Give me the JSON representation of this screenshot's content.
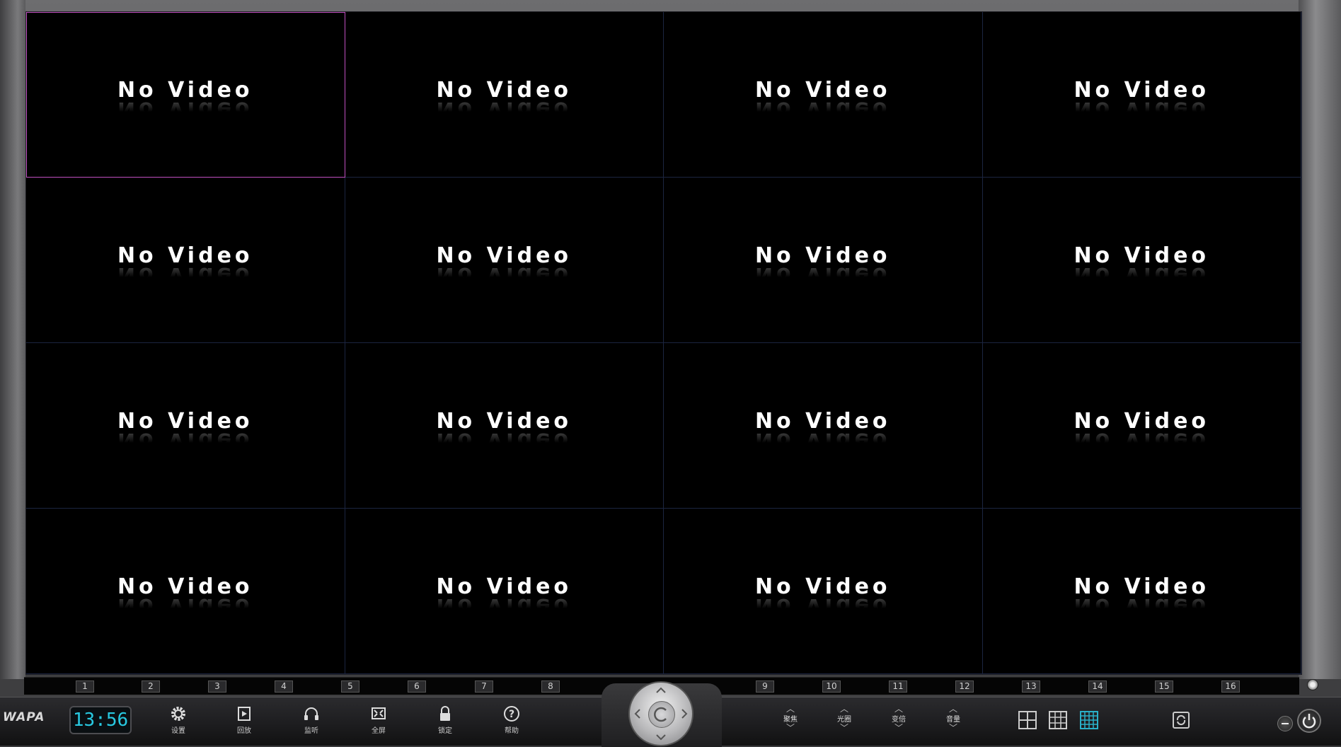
{
  "cells": [
    {
      "label": "No Video"
    },
    {
      "label": "No Video"
    },
    {
      "label": "No Video"
    },
    {
      "label": "No Video"
    },
    {
      "label": "No Video"
    },
    {
      "label": "No Video"
    },
    {
      "label": "No Video"
    },
    {
      "label": "No Video"
    },
    {
      "label": "No Video"
    },
    {
      "label": "No Video"
    },
    {
      "label": "No Video"
    },
    {
      "label": "No Video"
    },
    {
      "label": "No Video"
    },
    {
      "label": "No Video"
    },
    {
      "label": "No Video"
    },
    {
      "label": "No Video"
    }
  ],
  "selected_cell": 1,
  "channels": [
    "1",
    "2",
    "3",
    "4",
    "5",
    "6",
    "7",
    "8",
    "9",
    "10",
    "11",
    "12",
    "13",
    "14",
    "15",
    "16"
  ],
  "brand": "WAPA",
  "clock": "13:56",
  "toolbar": {
    "settings": {
      "label": "设置",
      "icon": "gear-icon"
    },
    "playback": {
      "label": "回放",
      "icon": "playback-icon"
    },
    "listen": {
      "label": "监听",
      "icon": "headphones-icon"
    },
    "fullscreen": {
      "label": "全屏",
      "icon": "fullscreen-icon"
    },
    "lock": {
      "label": "锁定",
      "icon": "lock-icon"
    },
    "help": {
      "label": "帮助",
      "icon": "help-icon"
    }
  },
  "adjust": {
    "focus": {
      "label": "聚焦"
    },
    "iris": {
      "label": "光圈"
    },
    "zoom": {
      "label": "变倍"
    },
    "volume": {
      "label": "音量"
    }
  },
  "layouts": {
    "quad": {
      "icon": "grid-2x2-icon"
    },
    "nine": {
      "icon": "grid-3x3-icon"
    },
    "sixteen": {
      "icon": "grid-4x4-icon",
      "active": true
    }
  },
  "colors": {
    "accent": "#28c8e0",
    "active_layout": "#2ab0c8",
    "selected_border": "#c050c0"
  }
}
